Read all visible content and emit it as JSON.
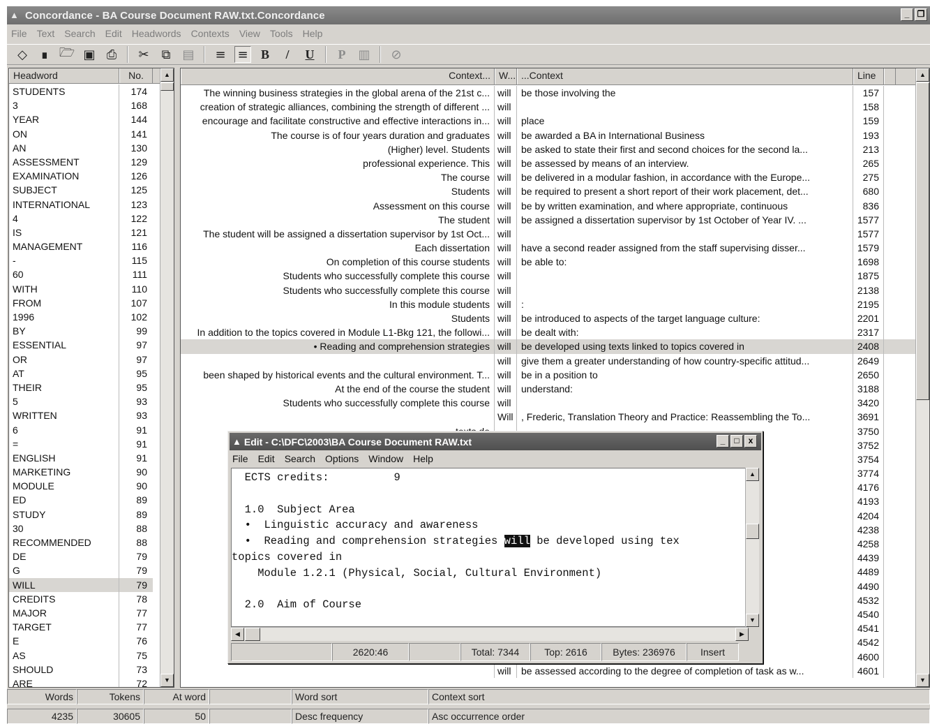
{
  "window": {
    "title": "Concordance - BA Course Document RAW.txt.Concordance",
    "controls": [
      "_",
      "❒",
      "x"
    ]
  },
  "menu": [
    "File",
    "Text",
    "Search",
    "Edit",
    "Headwords",
    "Contexts",
    "View",
    "Tools",
    "Help"
  ],
  "toolbar": {
    "icons": [
      "eraser-icon",
      "binoculars-icon",
      "open-folder-icon",
      "save-icon",
      "print-icon",
      "cut-icon",
      "copy-icon",
      "paste-icon",
      "align-left-icon",
      "align-center-icon",
      "bold-icon",
      "italic-icon",
      "underline-icon",
      "p-icon",
      "chart-icon",
      "disabled-icon"
    ],
    "bold_label": "B",
    "italic_label": "/",
    "underline_label": "U",
    "p_label": "P"
  },
  "headwords": {
    "col_headword": "Headword",
    "col_no": "No.",
    "rows": [
      {
        "w": "STUDENTS",
        "n": "174"
      },
      {
        "w": "3",
        "n": "168"
      },
      {
        "w": "YEAR",
        "n": "144"
      },
      {
        "w": "ON",
        "n": "141"
      },
      {
        "w": "AN",
        "n": "130"
      },
      {
        "w": "ASSESSMENT",
        "n": "129"
      },
      {
        "w": "EXAMINATION",
        "n": "126"
      },
      {
        "w": "SUBJECT",
        "n": "125"
      },
      {
        "w": "INTERNATIONAL",
        "n": "123"
      },
      {
        "w": "4",
        "n": "122"
      },
      {
        "w": "IS",
        "n": "121"
      },
      {
        "w": "MANAGEMENT",
        "n": "116"
      },
      {
        "w": "-",
        "n": "115"
      },
      {
        "w": "60",
        "n": "111"
      },
      {
        "w": "WITH",
        "n": "110"
      },
      {
        "w": "FROM",
        "n": "107"
      },
      {
        "w": "1996",
        "n": "102"
      },
      {
        "w": "BY",
        "n": "99"
      },
      {
        "w": "ESSENTIAL",
        "n": "97"
      },
      {
        "w": "OR",
        "n": "97"
      },
      {
        "w": "AT",
        "n": "95"
      },
      {
        "w": "THEIR",
        "n": "95"
      },
      {
        "w": "5",
        "n": "93"
      },
      {
        "w": "WRITTEN",
        "n": "93"
      },
      {
        "w": "6",
        "n": "91"
      },
      {
        "w": "=",
        "n": "91"
      },
      {
        "w": "ENGLISH",
        "n": "91"
      },
      {
        "w": "MARKETING",
        "n": "90"
      },
      {
        "w": "MODULE",
        "n": "90"
      },
      {
        "w": "ED",
        "n": "89"
      },
      {
        "w": "STUDY",
        "n": "89"
      },
      {
        "w": "30",
        "n": "88"
      },
      {
        "w": "RECOMMENDED",
        "n": "88"
      },
      {
        "w": "DE",
        "n": "79"
      },
      {
        "w": "G",
        "n": "79"
      },
      {
        "w": "WILL",
        "n": "79",
        "selected": true
      },
      {
        "w": "CREDITS",
        "n": "78"
      },
      {
        "w": "MAJOR",
        "n": "77"
      },
      {
        "w": "TARGET",
        "n": "77"
      },
      {
        "w": "E",
        "n": "76"
      },
      {
        "w": "AS",
        "n": "75"
      },
      {
        "w": "SHOULD",
        "n": "73"
      },
      {
        "w": "ARE",
        "n": "72"
      }
    ]
  },
  "concordance": {
    "col_left": "Context...",
    "col_word": "W...",
    "col_right": "...Context",
    "col_line": "Line",
    "rows": [
      {
        "l": "The winning business strategies in the global arena of the 21st c...",
        "k": "will",
        "r": "be those involving the",
        "n": "157"
      },
      {
        "l": "creation of strategic alliances, combining the strength of different ...",
        "k": "will",
        "r": "",
        "n": "158"
      },
      {
        "l": "encourage and facilitate constructive and effective interactions in...",
        "k": "will",
        "r": "place",
        "n": "159"
      },
      {
        "l": "The course is of four years duration and graduates",
        "k": "will",
        "r": "be awarded a BA in International Business",
        "n": "193"
      },
      {
        "l": "(Higher) level. Students",
        "k": "will",
        "r": "be asked to state their first and second choices for the second la...",
        "n": "213"
      },
      {
        "l": "professional experience. This",
        "k": "will",
        "r": "be assessed by means of an interview.",
        "n": "265"
      },
      {
        "l": "The course",
        "k": "will",
        "r": "be delivered in a modular fashion, in accordance with the Europe...",
        "n": "275"
      },
      {
        "l": "Students",
        "k": "will",
        "r": "be required to present a short report of their work placement, det...",
        "n": "680"
      },
      {
        "l": "Assessment on this course",
        "k": "will",
        "r": "be by written examination, and where appropriate, continuous",
        "n": "836"
      },
      {
        "l": "The student",
        "k": "will",
        "r": "be assigned a dissertation supervisor by 1st October of Year IV. ...",
        "n": "1577"
      },
      {
        "l": "The student will be assigned a dissertation supervisor by 1st Oct...",
        "k": "will",
        "r": "",
        "n": "1577"
      },
      {
        "l": "Each dissertation",
        "k": "will",
        "r": "have a second reader assigned from the staff supervising disser...",
        "n": "1579"
      },
      {
        "l": "On completion of this course students",
        "k": "will",
        "r": "be able to:",
        "n": "1698"
      },
      {
        "l": "Students who successfully complete this course",
        "k": "will",
        "r": "",
        "n": "1875"
      },
      {
        "l": "Students who successfully complete this course",
        "k": "will",
        "r": "",
        "n": "2138"
      },
      {
        "l": "In this module students",
        "k": "will",
        "r": ":",
        "n": "2195"
      },
      {
        "l": "Students",
        "k": "will",
        "r": "be introduced to aspects of the target language culture:",
        "n": "2201"
      },
      {
        "l": "In addition to the topics covered in Module L1-Bkg 121, the followi...",
        "k": "will",
        "r": "be dealt with:",
        "n": "2317"
      },
      {
        "l": "•  Reading and comprehension strategies",
        "k": "will",
        "r": "be developed using texts linked to topics covered in",
        "n": "2408",
        "selected": true
      },
      {
        "l": "",
        "k": "will",
        "r": "give them a greater understanding of how country-specific attitud...",
        "n": "2649"
      },
      {
        "l": "been shaped by historical events and the cultural environment. T...",
        "k": "will",
        "r": "be in a position to",
        "n": "2650"
      },
      {
        "l": "At the end of the course the student",
        "k": "will",
        "r": "understand:",
        "n": "3188"
      },
      {
        "l": "Students who successfully complete this course",
        "k": "will",
        "r": "",
        "n": "3420"
      },
      {
        "l": "",
        "k": "Will",
        "r": ", Frederic, Translation Theory and Practice: Reassembling the To...",
        "n": "3691"
      },
      {
        "l": "texts de",
        "k": "",
        "r": "",
        "n": "3750"
      },
      {
        "l": "",
        "k": "",
        "r": "etaphoric, a...",
        "n": "3752"
      },
      {
        "l": "",
        "k": "",
        "r": "",
        "n": "3754"
      },
      {
        "l": "",
        "k": "",
        "r": "fferences a...",
        "n": "3774"
      },
      {
        "l": "",
        "k": "",
        "r": "",
        "n": "4176"
      },
      {
        "l": "Commi",
        "k": "",
        "r": "",
        "n": "4193"
      },
      {
        "l": "",
        "k": "",
        "r": "s to:",
        "n": "4204"
      },
      {
        "l": "",
        "k": "",
        "r": "cement, det...",
        "n": "4238"
      },
      {
        "l": "",
        "k": "",
        "r": "h",
        "n": "4258"
      },
      {
        "l": "",
        "k": "",
        "r": "",
        "n": "4439"
      },
      {
        "l": "",
        "k": "",
        "r": "",
        "n": "4489"
      },
      {
        "l": "",
        "k": "",
        "r": "",
        "n": "4490"
      },
      {
        "l": "",
        "k": "",
        "r": "",
        "n": "4532"
      },
      {
        "l": "",
        "k": "",
        "r": "of Year IV. ...",
        "n": "4540"
      },
      {
        "l": "",
        "k": "",
        "r": "of the disser...",
        "n": "4541"
      },
      {
        "l": "",
        "k": "",
        "r": "ising",
        "n": "4542"
      },
      {
        "l": "",
        "k": "",
        "r": "rformance",
        "n": "4600"
      },
      {
        "l": "",
        "k": "will",
        "r": "be assessed according to the degree of completion of task as w...",
        "n": "4601"
      }
    ]
  },
  "status": {
    "words_label": "Words",
    "tokens_label": "Tokens",
    "atword_label": "At word",
    "wordsort_label": "Word sort",
    "contextsort_label": "Context sort",
    "words": "4235",
    "tokens": "30605",
    "atword": "50",
    "wordsort": "Desc frequency",
    "contextsort": "Asc occurrence order"
  },
  "edit": {
    "title": "Edit - C:\\DFC\\2003\\BA Course Document RAW.txt",
    "menu": [
      "File",
      "Edit",
      "Search",
      "Options",
      "Window",
      "Help"
    ],
    "line1": "  ECTS credits:          9",
    "line2": "",
    "line3": "  1.0  Subject Area",
    "line4": "  •  Linguistic accuracy and awareness",
    "line5_pre": "  •  Reading and comprehension strategies ",
    "line5_hl": "will",
    "line5_post": " be developed using tex",
    "line6": "topics covered in",
    "line7": "    Module 1.2.1 (Physical, Social, Cultural Environment)",
    "line8": "",
    "line9": "  2.0  Aim of Course",
    "status": {
      "pos": "2620:46",
      "total": "Total: 7344",
      "top": "Top: 2616",
      "bytes": "Bytes: 236976",
      "mode": "Insert"
    }
  }
}
